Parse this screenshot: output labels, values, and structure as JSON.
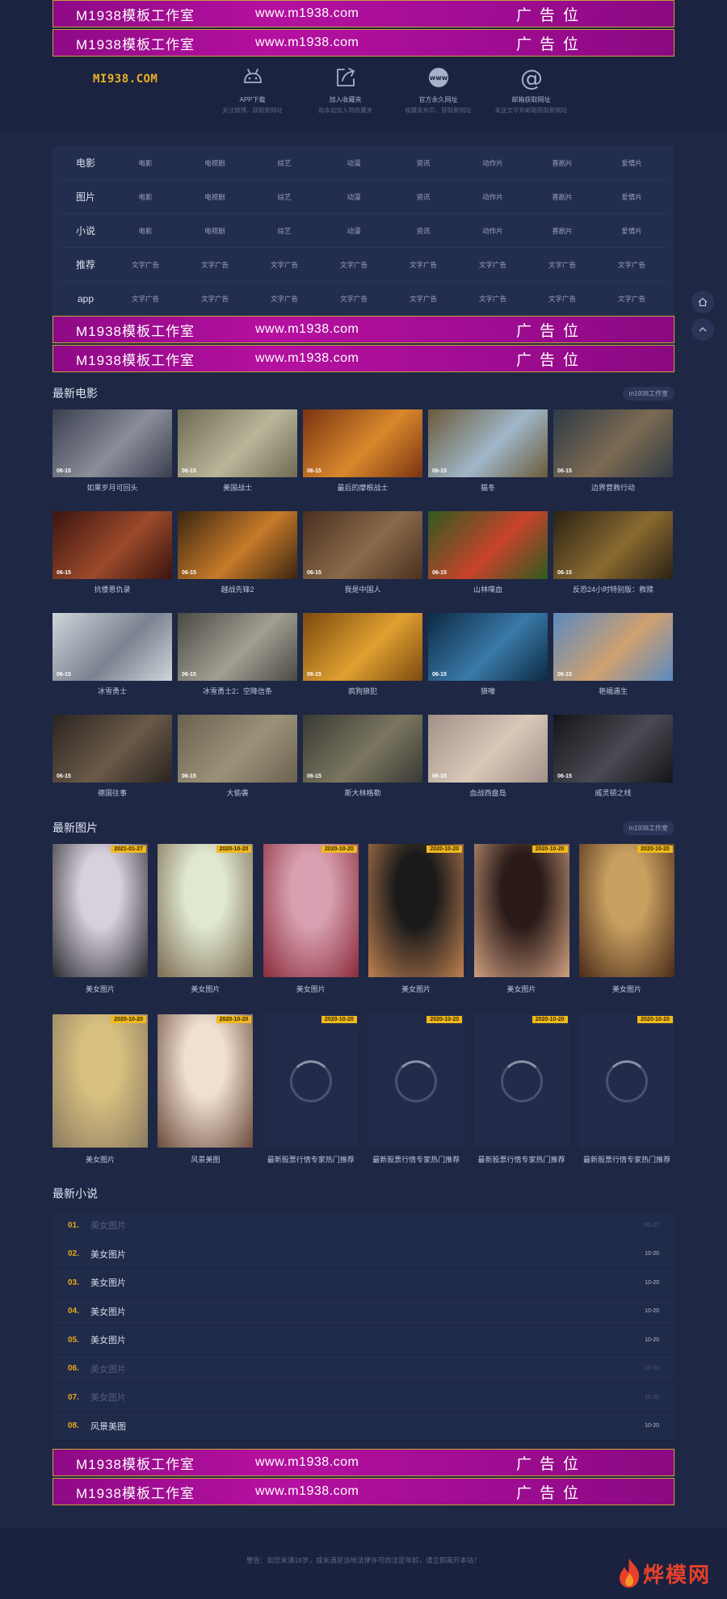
{
  "ads": {
    "brand": "M1938模板工作室",
    "url": "www.m1938.com",
    "spot": "广告位"
  },
  "header": {
    "logo": "MI938.COM",
    "links": [
      {
        "title": "APP下载",
        "sub": "关注微博，获取新网址",
        "icon": "android-icon"
      },
      {
        "title": "加入收藏夹",
        "sub": "用本站加入到收藏夹",
        "icon": "share-icon"
      },
      {
        "title": "官方永久网址",
        "sub": "收藏发布页，获取新网址",
        "icon": "www-icon"
      },
      {
        "title": "邮箱获取网址",
        "sub": "发送文字到邮箱获取新网址",
        "icon": "at-icon"
      }
    ]
  },
  "nav": [
    {
      "head": "电影",
      "items": [
        "电影",
        "电视剧",
        "综艺",
        "动漫",
        "资讯",
        "动作片",
        "喜剧片",
        "爱情片"
      ]
    },
    {
      "head": "图片",
      "items": [
        "电影",
        "电视剧",
        "综艺",
        "动漫",
        "资讯",
        "动作片",
        "喜剧片",
        "爱情片"
      ]
    },
    {
      "head": "小说",
      "items": [
        "电影",
        "电视剧",
        "综艺",
        "动漫",
        "资讯",
        "动作片",
        "喜剧片",
        "爱情片"
      ]
    },
    {
      "head": "推荐",
      "items": [
        "文字广告",
        "文字广告",
        "文字广告",
        "文字广告",
        "文字广告",
        "文字广告",
        "文字广告",
        "文字广告"
      ]
    },
    {
      "head": "app",
      "items": [
        "文字广告",
        "文字广告",
        "文字广告",
        "文字广告",
        "文字广告",
        "文字广告",
        "文字广告",
        "文字广告"
      ]
    }
  ],
  "movies": {
    "title": "最新电影",
    "tag": "m1938工作室",
    "items": [
      {
        "title": "如果岁月可回头",
        "date": "06-15"
      },
      {
        "title": "美国战士",
        "date": "06-15"
      },
      {
        "title": "最后的摩根战士",
        "date": "06-15"
      },
      {
        "title": "猫冬",
        "date": "06-15"
      },
      {
        "title": "边界营救行动",
        "date": "06-15"
      },
      {
        "title": "抗倭恩仇录",
        "date": "06-15"
      },
      {
        "title": "越战先锋2",
        "date": "06-15"
      },
      {
        "title": "我是中国人",
        "date": "06-15"
      },
      {
        "title": "山林喋血",
        "date": "06-15"
      },
      {
        "title": "反恐24小时特别版：救赎",
        "date": "06-15"
      },
      {
        "title": "冰雪勇士",
        "date": "06-15"
      },
      {
        "title": "冰雪勇士2：空降信条",
        "date": "06-15"
      },
      {
        "title": "疯狗狼犯",
        "date": "06-15"
      },
      {
        "title": "狼嚎",
        "date": "06-15"
      },
      {
        "title": "艳福遇生",
        "date": "06-15"
      },
      {
        "title": "德国往事",
        "date": "06-15"
      },
      {
        "title": "大偷袭",
        "date": "06-15"
      },
      {
        "title": "斯大林格勒",
        "date": "06-15"
      },
      {
        "title": "血战西盘岛",
        "date": "06-15"
      },
      {
        "title": "威灵顿之线",
        "date": "06-15"
      }
    ]
  },
  "pictures": {
    "title": "最新图片",
    "tag": "m1938工作室",
    "items": [
      {
        "title": "美女图片",
        "date": "2021-01-27"
      },
      {
        "title": "美女图片",
        "date": "2020-10-20"
      },
      {
        "title": "美女图片",
        "date": "2020-10-20"
      },
      {
        "title": "美女图片",
        "date": "2020-10-20"
      },
      {
        "title": "美女图片",
        "date": "2020-10-20"
      },
      {
        "title": "美女图片",
        "date": "2020-10-20"
      },
      {
        "title": "美女图片",
        "date": "2020-10-20"
      },
      {
        "title": "风景美图",
        "date": "2020-10-20"
      },
      {
        "title": "最新股票行情专家热门推荐",
        "date": "2020-10-20"
      },
      {
        "title": "最新股票行情专家热门推荐",
        "date": "2020-10-20"
      },
      {
        "title": "最新股票行情专家热门推荐",
        "date": "2020-10-20"
      },
      {
        "title": "最新股票行情专家热门推荐",
        "date": "2020-10-20"
      }
    ]
  },
  "novels": {
    "title": "最新小说",
    "items": [
      {
        "num": "01.",
        "title": "美女图片",
        "date": "01-27"
      },
      {
        "num": "02.",
        "title": "美女图片",
        "date": "10-20"
      },
      {
        "num": "03.",
        "title": "美女图片",
        "date": "10-20"
      },
      {
        "num": "04.",
        "title": "美女图片",
        "date": "10-20"
      },
      {
        "num": "05.",
        "title": "美女图片",
        "date": "10-20"
      },
      {
        "num": "06.",
        "title": "美女图片",
        "date": "10-20"
      },
      {
        "num": "07.",
        "title": "美女图片",
        "date": "10-20"
      },
      {
        "num": "08.",
        "title": "风景美图",
        "date": "10-20"
      }
    ]
  },
  "footer": {
    "text": "警告：如您未满18岁，或未满足当地法律许可的法定年龄，请立即离开本站！",
    "watermark": "烨模网"
  },
  "colors": {
    "background": "#1e2744",
    "ad_magenta": "#b5109f",
    "accent_gold": "#e8a91e",
    "watermark_red": "#e8402a"
  }
}
